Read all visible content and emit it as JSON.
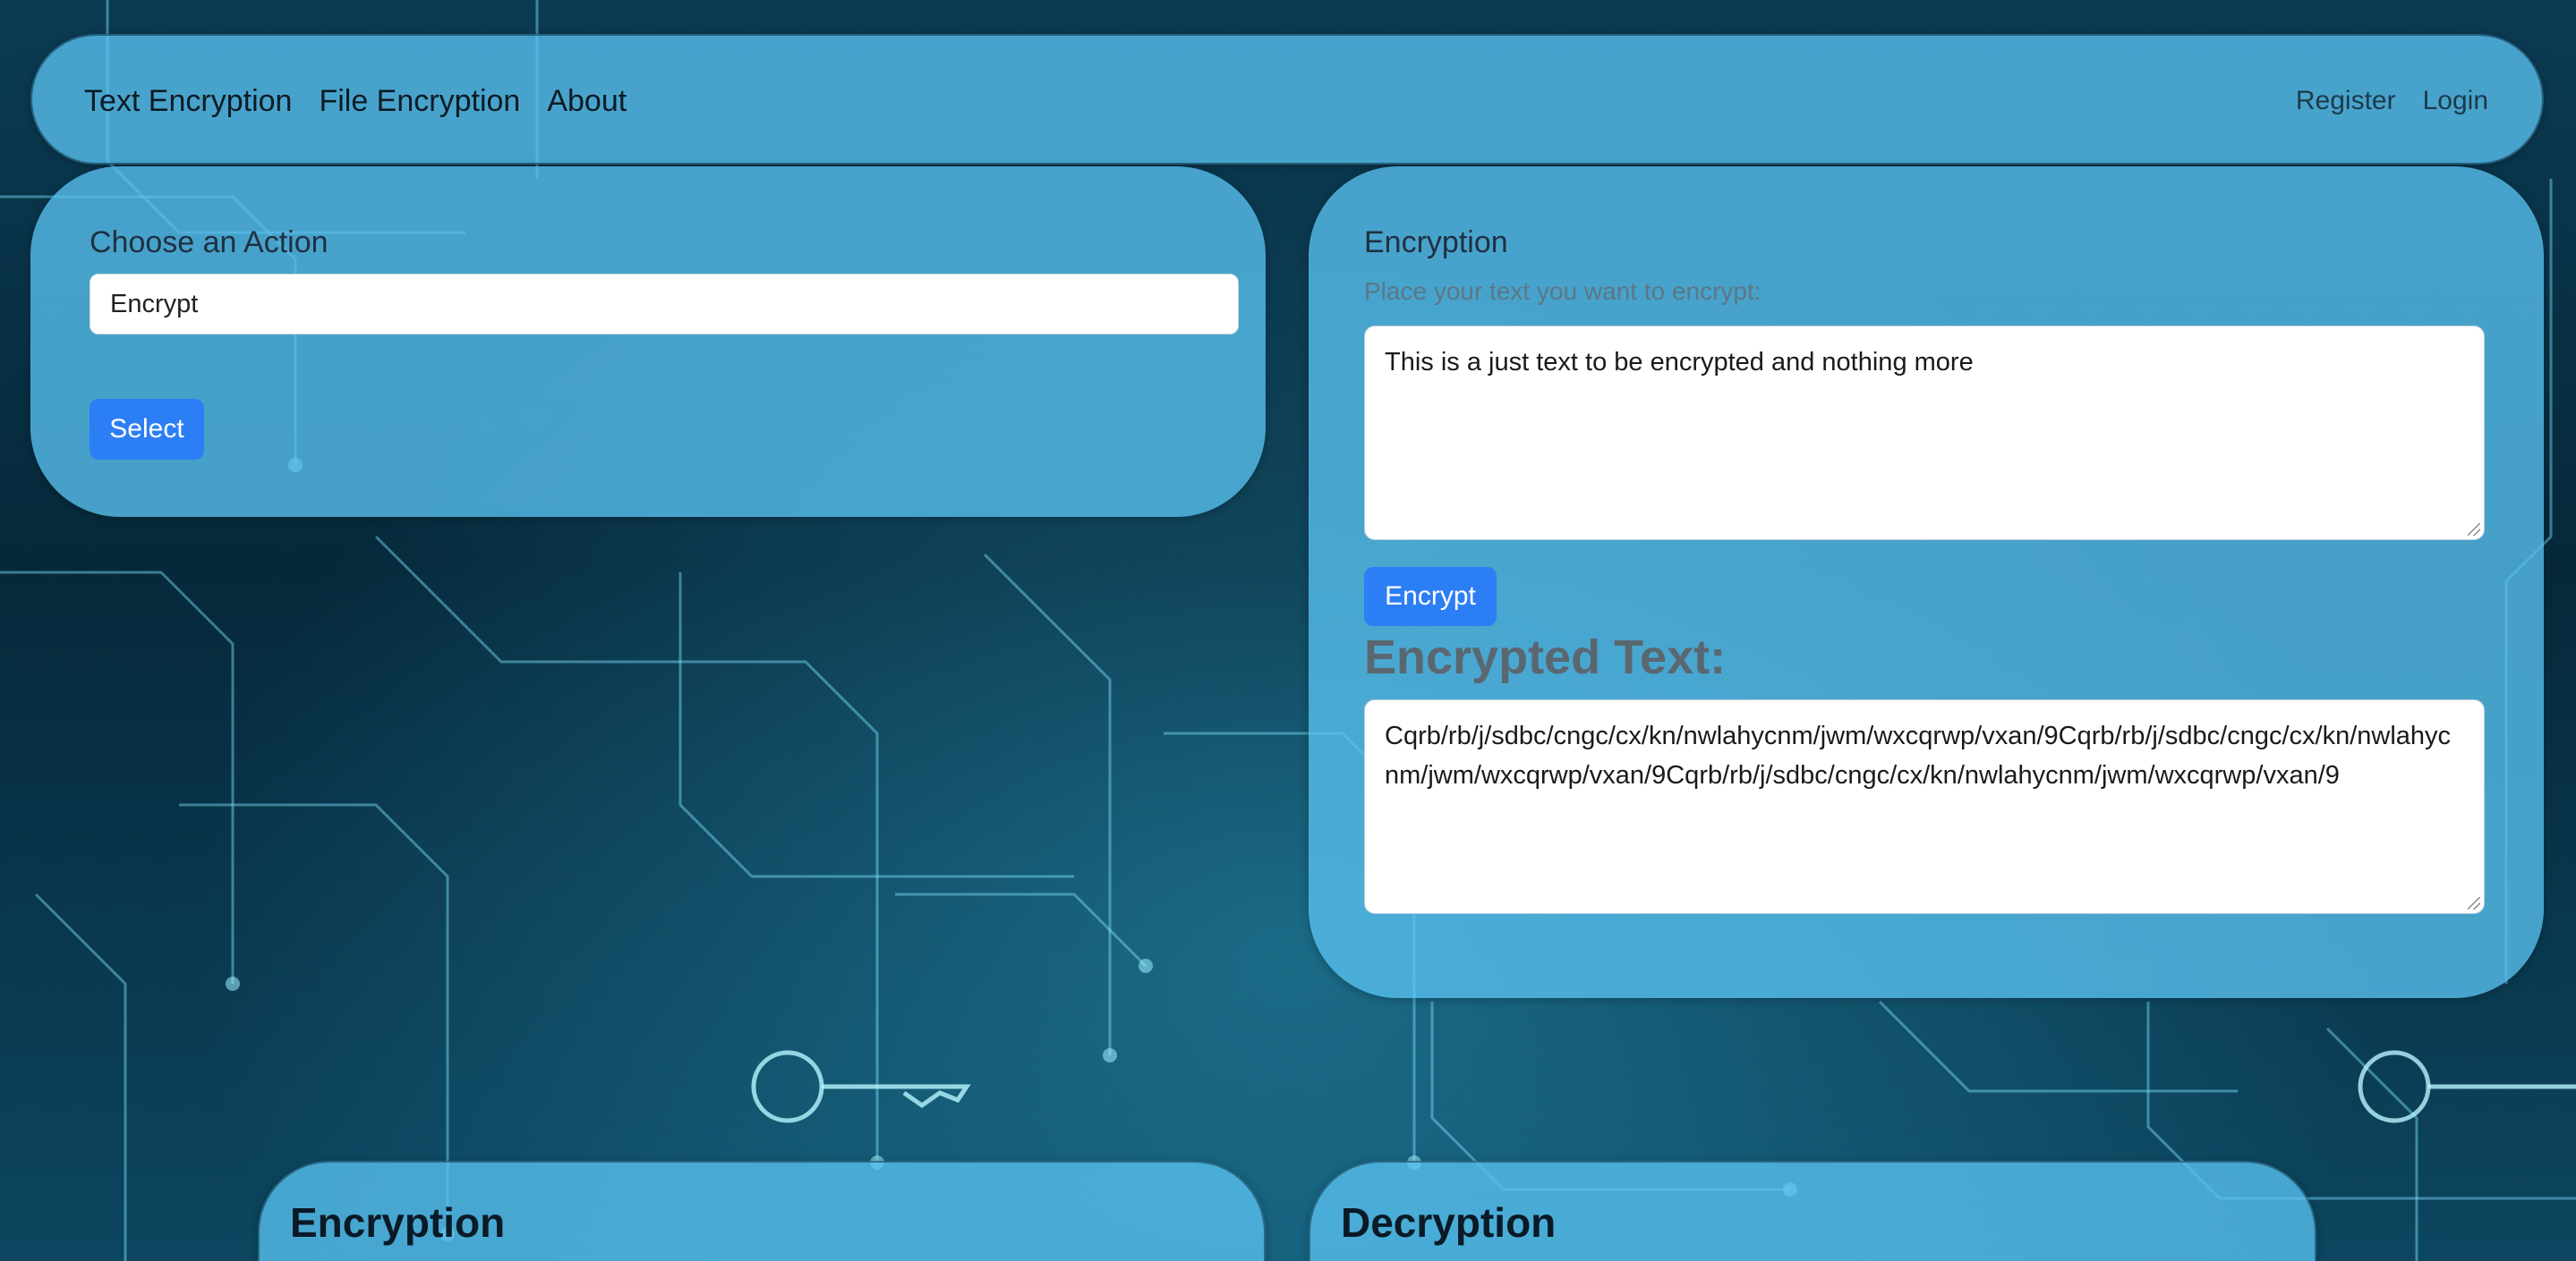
{
  "nav": {
    "left_links": [
      "Text Encryption",
      "File Encryption",
      "About"
    ],
    "right_links": [
      "Register",
      "Login"
    ]
  },
  "action": {
    "heading": "Choose an Action",
    "selected": "Encrypt",
    "button": "Select"
  },
  "encryption": {
    "heading": "Encryption",
    "hint": "Place your text you want to encrypt:",
    "input_text": "This is a just text to be encrypted and nothing more",
    "button": "Encrypt",
    "result_heading": "Encrypted Text:",
    "result_text": "Cqrb/rb/j/sdbc/cngc/cx/kn/nwlahycnm/jwm/wxcqrwp/vxan/9Cqrb/rb/j/sdbc/cngc/cx/kn/nwlahycnm/jwm/wxcqrwp/vxan/9Cqrb/rb/j/sdbc/cngc/cx/kn/nwlahycnm/jwm/wxcqrwp/vxan/9"
  },
  "bottom": {
    "encryption_title": "Encryption",
    "decryption_title": "Decryption"
  },
  "colors": {
    "panel": "#58c2f0",
    "button": "#2c7ef5"
  },
  "icons": [
    "key-icon",
    "circuit-background"
  ]
}
